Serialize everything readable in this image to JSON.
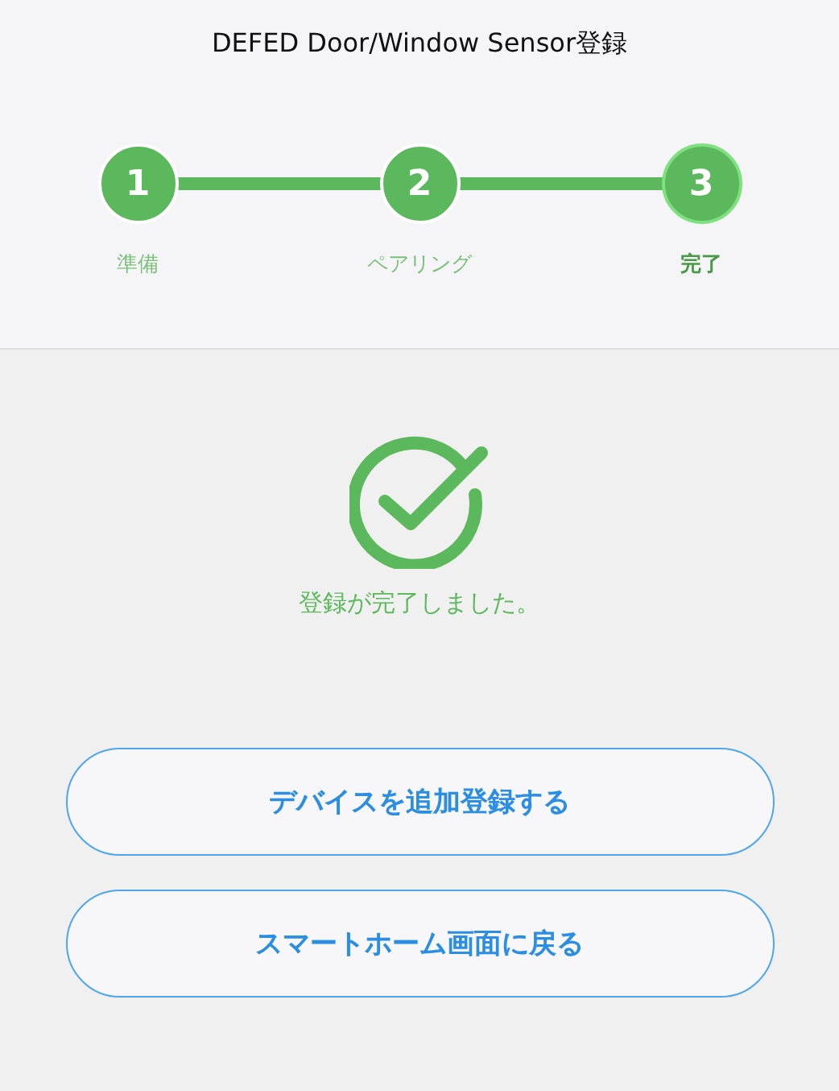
{
  "header": {
    "title": "DEFED Door/Window Sensor登録"
  },
  "steps": [
    {
      "number": "1",
      "label": "準備",
      "selected": false
    },
    {
      "number": "2",
      "label": "ペアリング",
      "selected": false
    },
    {
      "number": "3",
      "label": "完了",
      "selected": true
    }
  ],
  "result": {
    "message": "登録が完了しました。"
  },
  "buttons": [
    "デバイスを追加登録する",
    "スマートホーム画面に戻る"
  ]
}
